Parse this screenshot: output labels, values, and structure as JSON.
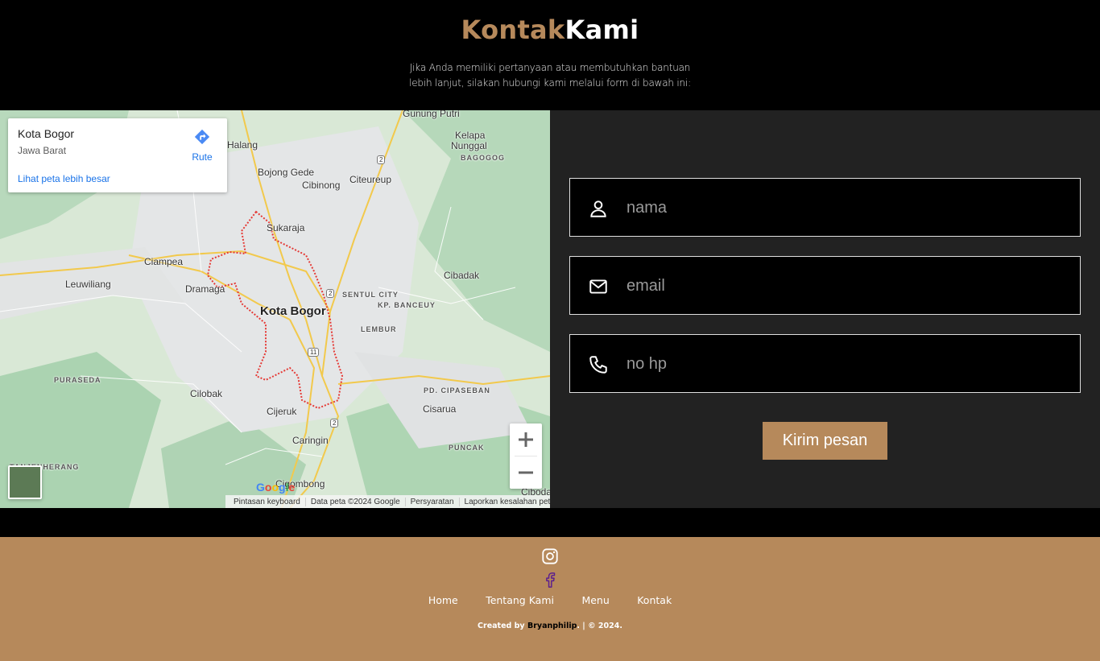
{
  "header": {
    "title_part1": "Kontak",
    "title_part2": "Kami",
    "subtitle_line1": "Jika Anda memiliki pertanyaan atau membutuhkan bantuan",
    "subtitle_line2": "lebih lanjut, silakan hubungi kami melalui form di bawah ini:",
    "accent_color": "#b6895b"
  },
  "map": {
    "card": {
      "place_name": "Kota Bogor",
      "region": "Jawa Barat",
      "route_label": "Rute",
      "larger_map_link": "Lihat peta lebih besar"
    },
    "labels": {
      "gunung_putri": "Gunung Putri",
      "kelapa_nunggal_1": "Kelapa",
      "kelapa_nunggal_2": "Nunggal",
      "bagogog": "BAGOGOG",
      "halang": "Halang",
      "bojong_gede": "Bojong Gede",
      "citeureup": "Citeureup",
      "cibinong": "Cibinong",
      "sukaraja": "Sukaraja",
      "ciampea": "Ciampea",
      "leuwiliang": "Leuwiliang",
      "dramaga": "Dramaga",
      "cibadak": "Cibadak",
      "sentul_city": "SENTUL CITY",
      "kp_banceuy": "KP. BANCEUY",
      "kota_bogor": "Kota Bogor",
      "lembur": "LEMBUR",
      "purasedaa": "PURASEDA",
      "cilobak": "Cilobak",
      "pd_cipaseban": "PD. CIPASEBAN",
      "cisarua": "Cisarua",
      "cijeruk": "Cijeruk",
      "caringin": "Caringin",
      "puncak": "PUNCAK",
      "tanjenherang": "TANJENHERANG",
      "cigombong": "Cigombong",
      "ciboda": "Ciboda",
      "route_2a": "2",
      "route_2b": "2",
      "route_2c": "2",
      "route_11": "11"
    },
    "attribution": {
      "shortcuts": "Pintasan keyboard",
      "data": "Data peta ©2024 Google",
      "terms": "Persyaratan",
      "report": "Laporkan kesalahan peta"
    },
    "google_logo": "Google"
  },
  "form": {
    "name_placeholder": "nama",
    "email_placeholder": "email",
    "phone_placeholder": "no hp",
    "submit_label": "Kirim pesan"
  },
  "footer": {
    "nav": [
      "Home",
      "Tentang Kami",
      "Menu",
      "Kontak"
    ],
    "credit_prefix": "Created by",
    "credit_name": "Bryanphilip",
    "credit_suffix": ". | © 2024."
  }
}
